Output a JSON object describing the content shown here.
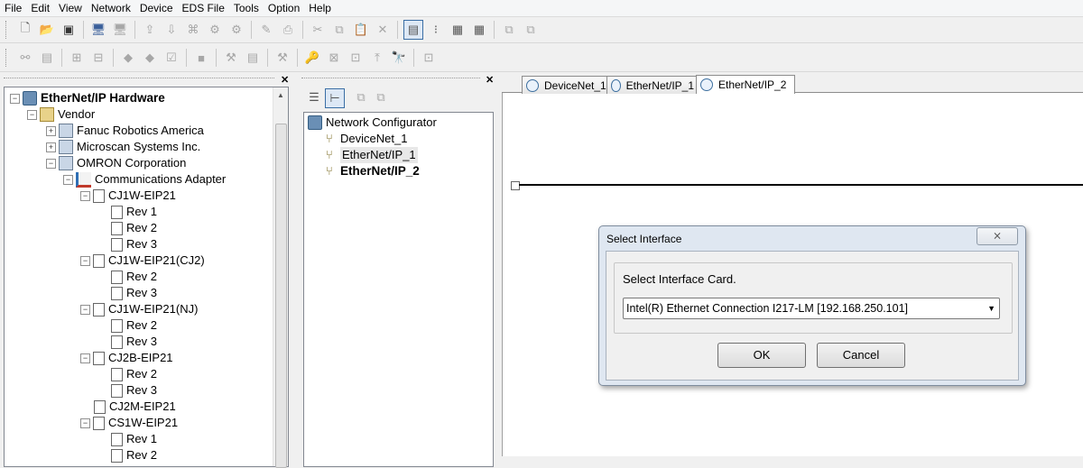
{
  "menu": [
    "File",
    "Edit",
    "View",
    "Network",
    "Device",
    "EDS File",
    "Tools",
    "Option",
    "Help"
  ],
  "toolbar1_icons": [
    "new-file-icon",
    "open-folder-icon",
    "save-icon",
    "connect-icon",
    "disconnect-icon",
    "upload-icon",
    "download-icon",
    "monitor-icon",
    "cut-icon",
    "copy-icon",
    "paste-icon",
    "delete-icon",
    "view-icon",
    "grid-icon",
    "table-icon"
  ],
  "hardware_tree": {
    "root": "EtherNet/IP Hardware",
    "vendor": "Vendor",
    "vendors": [
      "Fanuc Robotics America",
      "Microscan Systems Inc.",
      "OMRON Corporation"
    ],
    "category": "Communications Adapter",
    "devices": [
      {
        "name": "CJ1W-EIP21",
        "revs": [
          "Rev 1",
          "Rev 2",
          "Rev 3"
        ]
      },
      {
        "name": "CJ1W-EIP21(CJ2)",
        "revs": [
          "Rev 2",
          "Rev 3"
        ]
      },
      {
        "name": "CJ1W-EIP21(NJ)",
        "revs": [
          "Rev 2",
          "Rev 3"
        ]
      },
      {
        "name": "CJ2B-EIP21",
        "revs": [
          "Rev 2",
          "Rev 3"
        ]
      },
      {
        "name": "CJ2M-EIP21",
        "revs": []
      },
      {
        "name": "CS1W-EIP21",
        "revs": [
          "Rev 1",
          "Rev 2"
        ]
      }
    ]
  },
  "network_tree": {
    "root": "Network Configurator",
    "items": [
      "DeviceNet_1",
      "EtherNet/IP_1",
      "EtherNet/IP_2"
    ]
  },
  "tabs": [
    "DeviceNet_1",
    "EtherNet/IP_1",
    "EtherNet/IP_2"
  ],
  "dialog": {
    "title": "Select Interface",
    "close": "⨯",
    "label": "Select Interface Card.",
    "selected": "Intel(R) Ethernet Connection I217-LM [192.168.250.101]",
    "ok": "OK",
    "cancel": "Cancel"
  }
}
